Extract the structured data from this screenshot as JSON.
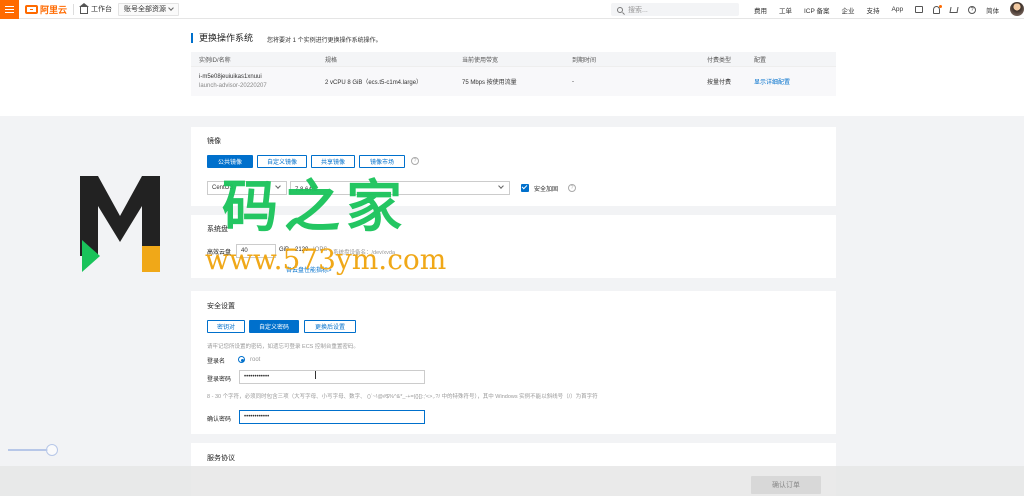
{
  "topbar": {
    "logo_text": "阿里云",
    "workbench": "工作台",
    "resource_select": "账号全部资源",
    "search_placeholder": "搜索...",
    "links": [
      "费用",
      "工单",
      "ICP 备案",
      "企业",
      "支持",
      "App"
    ],
    "language": "简体"
  },
  "system_section": {
    "title": "更换操作系统",
    "subtitle": "您将要对 1 个实例进行更换操作系统操作。",
    "columns": [
      "实例ID/名称",
      "规格",
      "当前使用带宽",
      "到期时间",
      "付费类型",
      "配置"
    ],
    "row": {
      "instance_id": "i-m5e08jeuiuikas1xnuui",
      "instance_name": "launch-advisor-20220207",
      "spec": "2 vCPU 8 GiB（ecs.t5-c1m4.large）",
      "bandwidth": "75 Mbps 按使用流量",
      "expire": "-",
      "pay_type": "按量付费",
      "config_link": "显示详细配置"
    }
  },
  "image_section": {
    "title": "镜像",
    "tabs": [
      "公共镜像",
      "自定义镜像",
      "共享镜像",
      "镜像市场"
    ],
    "os": "CentOS",
    "version": "7.8 64位",
    "security_hardening": "安全加固"
  },
  "disk_section": {
    "title": "系统盘",
    "disk_type": "高效云盘",
    "size": "40",
    "unit": "GiB",
    "iops": "2120",
    "iops_label": "IOPS",
    "device_text": "系统盘设备名：/dev/xvda",
    "warning_link": "各云盘性能指标>"
  },
  "security_section": {
    "title": "安全设置",
    "tabs": [
      "密钥对",
      "自定义密码",
      "更换后设置"
    ],
    "hint": "请牢记您所设置的密码，如遗忘可登录 ECS 控制台重置密码。",
    "login_name_label": "登录名",
    "login_name": "root",
    "password_label": "登录密码",
    "password_value": "••••••••••••",
    "password_rule": "8 - 30 个字符，必须同时包含三项（大写字母、小写字母、数字、 ()`~!@#$%^&*_-+=|{}[]:;'<>,.?/ 中的特殊符号），其中 Windows 实例不能以斜线号（/）为首字符",
    "confirm_label": "确认密码",
    "confirm_value": "••••••••••••"
  },
  "service_section": {
    "title": "服务协议"
  },
  "footer": {
    "confirm_order": "确认订单"
  },
  "watermark": {
    "big_text": "码之家",
    "url": "www.573ym.com"
  },
  "colors": {
    "brand": "#ff6a00",
    "primary": "#0070cc"
  }
}
